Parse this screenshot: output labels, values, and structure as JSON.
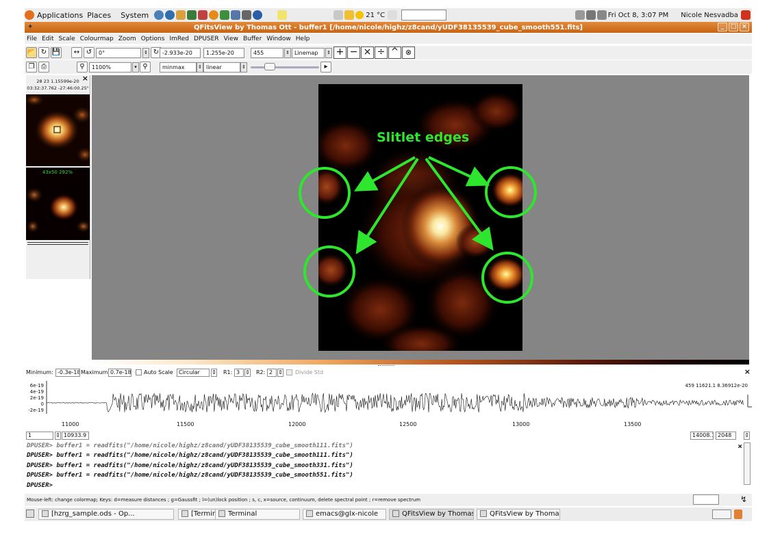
{
  "top_panel": {
    "applications": "Applications",
    "places": "Places",
    "system": "System",
    "weather": "21 °C",
    "datetime": "Fri Oct  8,  3:07 PM",
    "user": "Nicole Nesvadba"
  },
  "window": {
    "title": "QFitsView by Thomas Ott - buffer1 [/home/nicole/highz/z8cand/yUDF38135539_cube_smooth551.fits]"
  },
  "menu": [
    "File",
    "Edit",
    "Scale",
    "Colourmap",
    "Zoom",
    "Options",
    "ImRed",
    "DPUSER",
    "View",
    "Buffer",
    "Window",
    "Help"
  ],
  "toolbar1": {
    "rotation": "0°",
    "min_value": "-2.933e-20",
    "max_value": "1.255e-20",
    "frame": "455",
    "mode": "Linemap"
  },
  "toolbar2": {
    "zoom": "1100%",
    "scale_method": "minmax",
    "scale_type": "linear"
  },
  "left_panel": {
    "coords_line1": "28 23 1.15599e-20",
    "coords_line2": "03:32:37.762 -27:46:00.25\"",
    "zoom_label": "43x50  292%"
  },
  "annotation": {
    "label": "Slitlet edges"
  },
  "spectrum_controls": {
    "minimum_label": "Minimum:",
    "minimum_value": "-0.3e-18",
    "maximum_label": "Maximum:",
    "maximum_value": "0.7e-18",
    "auto_scale": "Auto Scale",
    "aperture": "Circular",
    "r1_label": "R1:",
    "r1_value": "3",
    "r2_label": "R2:",
    "r2_value": "2",
    "divide_std": "Divide Std"
  },
  "spectrum": {
    "y_ticks": [
      "6e-19",
      "4e-19",
      "2e-19",
      "0",
      "-2e-19"
    ],
    "x_ticks": [
      "11000",
      "11500",
      "12000",
      "12500",
      "13000",
      "13500"
    ],
    "cursor_readout": "459 11621.1 8.36912e-20",
    "start_index": "1",
    "start_wavelength": "10933.9",
    "end_wavelength": "14008.1",
    "end_index": "2048"
  },
  "console": {
    "lines": [
      "DPUSER> buffer1 = readfits(\"/home/nicole/highz/z8cand/yUDF38135539_cube_smooth111.fits\")",
      "DPUSER> buffer1 = readfits(\"/home/nicole/highz/z8cand/yUDF38135539_cube_smooth111.fits\")",
      "DPUSER> buffer1 = readfits(\"/home/nicole/highz/z8cand/yUDF38135539_cube_smooth331.fits\")",
      "DPUSER> buffer1 = readfits(\"/home/nicole/highz/z8cand/yUDF38135539_cube_smooth551.fits\")",
      "DPUSER>"
    ]
  },
  "status": "Mouse-left: change colormap; Keys: d=measure distances ; g=Gaussfit ; l=(un)lock position ; s, c, x=source, continuum, delete spectral point ; r=remove spectrum",
  "taskbar": [
    {
      "label": "[hzrg_sample.ods - Op...",
      "icon": "document-icon"
    },
    {
      "label": "[Terminal]",
      "icon": "terminal-icon"
    },
    {
      "label": "Terminal",
      "icon": "terminal-icon"
    },
    {
      "label": "emacs@glx-nicole",
      "icon": "emacs-icon"
    },
    {
      "label": "QFitsView by Thomas ...",
      "icon": "qfitsview-icon"
    },
    {
      "label": "QFitsView by Thomas ...",
      "icon": "qfitsview-icon"
    }
  ],
  "colors": {
    "title_orange": "#d2731f",
    "annotation_green": "#2ee62e"
  }
}
